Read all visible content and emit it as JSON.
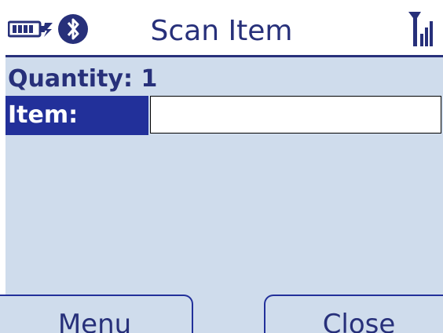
{
  "title_bar": {
    "title": "Scan Item",
    "battery_icon": "battery-icon",
    "bluetooth_icon": "bluetooth-icon",
    "signal_icon": "signal-strength-icon"
  },
  "form": {
    "quantity_label": "Quantity:",
    "quantity_value": "1",
    "item_label": "Item:",
    "item_value": ""
  },
  "softkeys": {
    "left_label": "Menu",
    "right_label": "Close"
  },
  "colors": {
    "accent": "#22309a",
    "title_text": "#27307a",
    "content_background": "#cfdcec",
    "input_background": "#ffffff"
  }
}
